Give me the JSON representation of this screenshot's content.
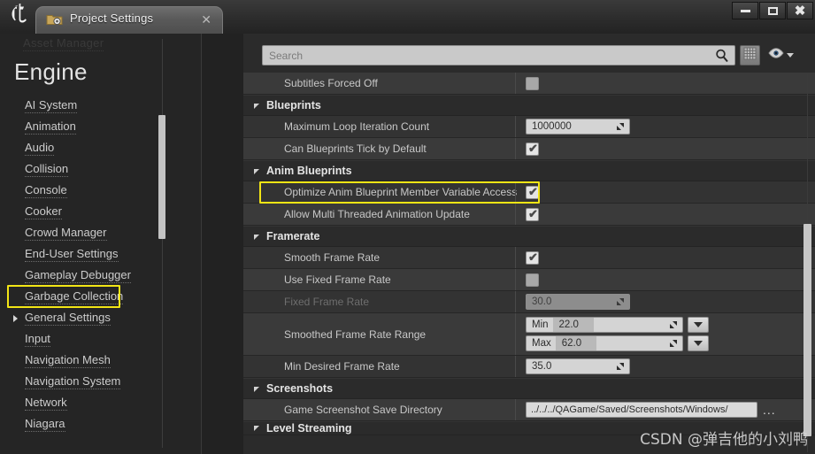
{
  "window": {
    "title": "Project Settings",
    "logo": "\u0001",
    "tab_icon_name": "folder-gear-icon",
    "close_label": "✕",
    "minimize_label": "minimize",
    "maximize_label": "maximize",
    "close_btn_label": "✖"
  },
  "sidebar": {
    "clipped_item": "Asset Manager",
    "group_title": "Engine",
    "items": [
      {
        "label": "AI System",
        "selected": false,
        "expandable": false
      },
      {
        "label": "Animation",
        "selected": false,
        "expandable": false
      },
      {
        "label": "Audio",
        "selected": false,
        "expandable": false
      },
      {
        "label": "Collision",
        "selected": false,
        "expandable": false
      },
      {
        "label": "Console",
        "selected": false,
        "expandable": false
      },
      {
        "label": "Cooker",
        "selected": false,
        "expandable": false
      },
      {
        "label": "Crowd Manager",
        "selected": false,
        "expandable": false
      },
      {
        "label": "End-User Settings",
        "selected": false,
        "expandable": false
      },
      {
        "label": "Gameplay Debugger",
        "selected": false,
        "expandable": false
      },
      {
        "label": "Garbage Collection",
        "selected": false,
        "expandable": false
      },
      {
        "label": "General Settings",
        "selected": true,
        "expandable": true
      },
      {
        "label": "Input",
        "selected": false,
        "expandable": false
      },
      {
        "label": "Navigation Mesh",
        "selected": false,
        "expandable": false
      },
      {
        "label": "Navigation System",
        "selected": false,
        "expandable": false
      },
      {
        "label": "Network",
        "selected": false,
        "expandable": false
      },
      {
        "label": "Niagara",
        "selected": false,
        "expandable": false
      }
    ]
  },
  "toolbar": {
    "search_value": "",
    "search_placeholder": "Search",
    "search_icon": "search-icon",
    "grid_icon": "grid-view-icon",
    "eye_icon": "visibility-eye-icon"
  },
  "settings": {
    "row_0": {
      "name": "Subtitles Forced Off",
      "type": "checkbox",
      "checked": false
    },
    "cat_blueprints": "Blueprints",
    "row_max_loop": {
      "name": "Maximum Loop Iteration Count",
      "type": "number",
      "value": "1000000"
    },
    "row_bp_tick": {
      "name": "Can Blueprints Tick by Default",
      "type": "checkbox",
      "checked": true
    },
    "cat_anim_blueprints": "Anim Blueprints",
    "row_optimize": {
      "name": "Optimize Anim Blueprint Member Variable Access",
      "type": "checkbox",
      "checked": true,
      "highlighted": true
    },
    "row_multithread": {
      "name": "Allow Multi Threaded Animation Update",
      "type": "checkbox",
      "checked": true
    },
    "cat_framerate": "Framerate",
    "row_smooth": {
      "name": "Smooth Frame Rate",
      "type": "checkbox",
      "checked": true
    },
    "row_use_fixed": {
      "name": "Use Fixed Frame Rate",
      "type": "checkbox",
      "checked": false
    },
    "row_fixed": {
      "name": "Fixed Frame Rate",
      "type": "number",
      "value": "30.0",
      "disabled": true
    },
    "row_smoothed_range": {
      "name": "Smoothed Frame Rate Range",
      "type": "range",
      "min_label": "Min",
      "min_value": "22.0",
      "max_label": "Max",
      "max_value": "62.0"
    },
    "row_min_desired": {
      "name": "Min Desired Frame Rate",
      "type": "number",
      "value": "35.0"
    },
    "cat_screenshots": "Screenshots",
    "row_screenshot_dir": {
      "name": "Game Screenshot Save Directory",
      "type": "path",
      "value": "../../../QAGame/Saved/Screenshots/Windows/",
      "browse_label": "..."
    },
    "cat_level_streaming": "Level Streaming"
  },
  "watermark": {
    "text": "CSDN @弹吉他的小刘鸭"
  },
  "colors": {
    "highlight": "#f2e515",
    "panel_bg": "#2b2b2b",
    "row_light": "#3a3a3a",
    "row_dark": "#333333"
  }
}
